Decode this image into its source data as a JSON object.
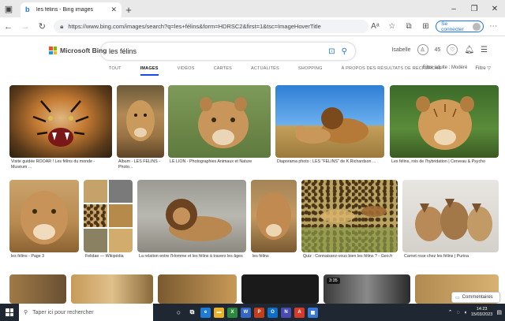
{
  "browser": {
    "tab_title": "les félins - Bing images",
    "tab_favicon": "b",
    "url": "https://www.bing.com/images/search?q=les+f%c3%a9lins&form=HDRSC2&first=1&tsc=ImageHoverTitle",
    "url_display": "https://www.bing.com/images/search?q=les+félins&form=HDRSC2&first=1&tsc=ImageHoverTitle",
    "connect_label": "Se connecter"
  },
  "bing": {
    "logo_text": "Microsoft Bing",
    "query": "les félins",
    "user_name": "Isabelle",
    "rewards": "45",
    "scopes": [
      "TOUT",
      "IMAGES",
      "VIDÉOS",
      "CARTES",
      "ACTUALITÉS",
      "SHOPPING",
      "À PROPOS DES RÉSULTATS DE RECHERCHE"
    ],
    "active_scope": "IMAGES",
    "filter_adult": "Filtre adulte : Modéré",
    "filter_label": "Filtre"
  },
  "images": {
    "row1": [
      {
        "caption": "Visite guidée ROOAR ! Les félins du monde - Muséum ..."
      },
      {
        "caption": "Album - LES FÉLINS - Photo..."
      },
      {
        "caption": "LE LION - Photographies Animaux et Nature"
      },
      {
        "caption": "Diaporama photo : LES \"FÉLINS\" de K.Richardson ..."
      },
      {
        "caption": "Les félins, rois de l'hybridation | Cerveau & Psycho"
      }
    ],
    "row2": [
      {
        "caption": "les félins - Page 3"
      },
      {
        "caption": "Felidae — Wikipédia"
      },
      {
        "caption": "La relation entre l'Homme et les félins à travers les âges"
      },
      {
        "caption": "les félins"
      },
      {
        "caption": "Quiz : Connaissez-vous bien les félins ? - Geo.fr"
      },
      {
        "caption": "Carnet rose chez les félins | Purina"
      }
    ],
    "row3_badge": "3:35"
  },
  "feedback_label": "Commentaires",
  "taskbar": {
    "search_placeholder": "Taper ici pour rechercher",
    "time": "14:23",
    "date": "15/03/2023"
  },
  "colors": {
    "bing_blue": "#174ae4",
    "taskbar_bg": "#1e2732"
  }
}
